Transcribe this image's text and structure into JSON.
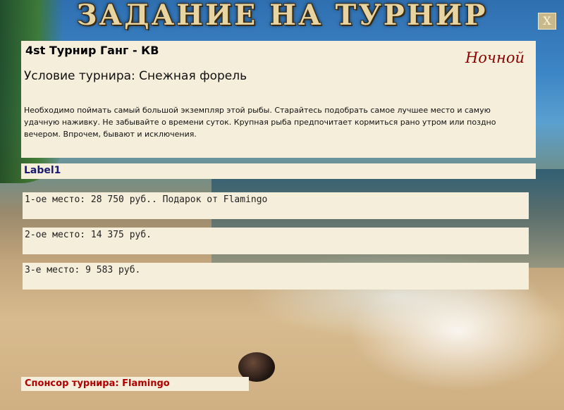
{
  "window": {
    "title": "ЗАДАНИЕ НА ТУРНИР",
    "close_label": "X"
  },
  "tournament": {
    "name": "4st Турнир Ганг - КВ",
    "time_of_day": "Ночной",
    "condition": "Условие турнира: Снежная форель",
    "description": "Необходимо поймать самый большой экземпляр этой рыбы. Старайтесь подобрать самое лучшее место и самую удачную наживку. Не забывайте о времени суток. Крупная рыба предпочитает кормиться рано утром или поздно вечером. Впрочем, бывают и исключения."
  },
  "label1": "Label1",
  "prizes": [
    "1-ое место: 28 750 руб.. Подарок от Flamingo",
    "2-ое место: 14 375 руб.",
    "3-е место: 9 583 руб."
  ],
  "sponsor": "Спонсор турнира: Flamingo",
  "colors": {
    "panel_bg": "#f5eedb",
    "time_of_day": "#8b0000",
    "label1": "#1a1a70",
    "sponsor": "#b00000",
    "title_text": "#e8d4a0"
  }
}
